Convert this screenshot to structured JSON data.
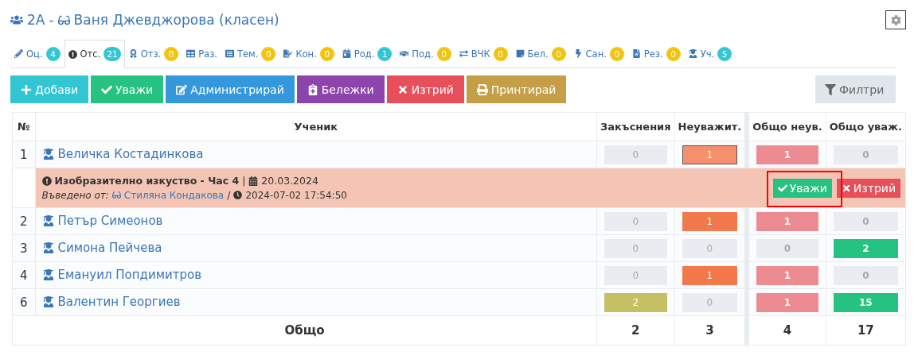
{
  "header": {
    "class_name": "2А",
    "separator": "-",
    "teacher": "Ваня Джевджорова (класен)"
  },
  "tabs": [
    {
      "label": "Оц.",
      "badge": "4",
      "color": "#36c6d3",
      "selected": false
    },
    {
      "label": "Отс.",
      "badge": "21",
      "color": "#36c6d3",
      "selected": true
    },
    {
      "label": "Отз.",
      "badge": "0",
      "color": "#f1c40f",
      "selected": false
    },
    {
      "label": "Раз.",
      "selected": false
    },
    {
      "label": "Тем.",
      "badge": "0",
      "color": "#f1c40f",
      "selected": false
    },
    {
      "label": "Кон.",
      "badge": "0",
      "color": "#f1c40f",
      "selected": false
    },
    {
      "label": "Род.",
      "badge": "1",
      "color": "#36c6d3",
      "selected": false
    },
    {
      "label": "Под.",
      "badge": "0",
      "color": "#f1c40f",
      "selected": false
    },
    {
      "label": "ВЧК",
      "badge": "0",
      "color": "#f1c40f",
      "selected": false
    },
    {
      "label": "Бел.",
      "badge": "0",
      "color": "#f1c40f",
      "selected": false
    },
    {
      "label": "Сан.",
      "badge": "0",
      "color": "#f1c40f",
      "selected": false
    },
    {
      "label": "Рез.",
      "badge": "0",
      "color": "#f1c40f",
      "selected": false
    },
    {
      "label": "Уч.",
      "badge": "5",
      "color": "#36c6d3",
      "selected": false
    }
  ],
  "toolbar": [
    {
      "label": "Добави",
      "color": "#32c5d2"
    },
    {
      "label": "Уважи",
      "color": "#26c281"
    },
    {
      "label": "Администрирай",
      "color": "#3598dc"
    },
    {
      "label": "Бележки",
      "color": "#8e44ad"
    },
    {
      "label": "Изтрий",
      "color": "#e7505a"
    },
    {
      "label": "Принтирай",
      "color": "#c49f47"
    }
  ],
  "filter_button": "Филтри",
  "table": {
    "columns": [
      "№",
      "Ученик",
      "Закъснения",
      "Неуважит.",
      "Общо неув.",
      "Общо уваж."
    ],
    "rows": [
      {
        "expanded": true,
        "cells": [
          {
            "value": "1"
          },
          {
            "value": "Величка Костадинкова"
          },
          {
            "value": "0",
            "kind": "empty",
            "color": "#e9ecf1"
          },
          {
            "value": "1",
            "kind": "filled",
            "color": "#f4906b"
          },
          {
            "value": "1",
            "kind": "filled",
            "color": "#ed8b93"
          },
          {
            "value": "0",
            "kind": "empty",
            "color": "#e9ecf1"
          }
        ],
        "detail": {
          "subject": "Изобразително изкуство - Час 4",
          "separator": "|",
          "date": "20.03.2024",
          "entered_label": "Въведено от:",
          "author": "Стиляна Кондакова",
          "slash": "/",
          "timestamp": "2024-07-02 17:54:50",
          "actions": [
            {
              "label": "Уважи",
              "color": "#26c281",
              "highlighted": true
            },
            {
              "label": "Изтрий",
              "color": "#e7505a",
              "highlighted": false
            }
          ]
        }
      },
      {
        "expanded": false,
        "cells": [
          {
            "value": "2"
          },
          {
            "value": "Петър Симеонов"
          },
          {
            "value": "0",
            "kind": "empty",
            "color": "#e9ecf1"
          },
          {
            "value": "1",
            "kind": "filled",
            "color": "#f3794c"
          },
          {
            "value": "1",
            "kind": "filled",
            "color": "#ed8b93"
          },
          {
            "value": "0",
            "kind": "empty",
            "color": "#e9ecf1"
          }
        ]
      },
      {
        "expanded": false,
        "cells": [
          {
            "value": "3"
          },
          {
            "value": "Симона Пейчева"
          },
          {
            "value": "0",
            "kind": "empty",
            "color": "#e9ecf1"
          },
          {
            "value": "0",
            "kind": "empty",
            "color": "#e9ecf1"
          },
          {
            "value": "0",
            "kind": "empty",
            "color": "#e9ecf1"
          },
          {
            "value": "2",
            "kind": "filled",
            "color": "#26c281"
          }
        ]
      },
      {
        "expanded": false,
        "cells": [
          {
            "value": "4"
          },
          {
            "value": "Емануил Попдимитров"
          },
          {
            "value": "0",
            "kind": "empty",
            "color": "#e9ecf1"
          },
          {
            "value": "1",
            "kind": "filled",
            "color": "#f3794c"
          },
          {
            "value": "1",
            "kind": "filled",
            "color": "#ed8b93"
          },
          {
            "value": "0",
            "kind": "empty",
            "color": "#e9ecf1"
          }
        ]
      },
      {
        "expanded": false,
        "cells": [
          {
            "value": "6"
          },
          {
            "value": "Валентин Георгиев"
          },
          {
            "value": "2",
            "kind": "filled",
            "color": "#c5c063"
          },
          {
            "value": "0",
            "kind": "empty",
            "color": "#e9ecf1"
          },
          {
            "value": "1",
            "kind": "filled",
            "color": "#ed8b93"
          },
          {
            "value": "15",
            "kind": "filled",
            "color": "#26c281"
          }
        ]
      }
    ],
    "total": {
      "label": "Общо",
      "values": [
        "2",
        "3",
        "4",
        "17"
      ]
    }
  }
}
